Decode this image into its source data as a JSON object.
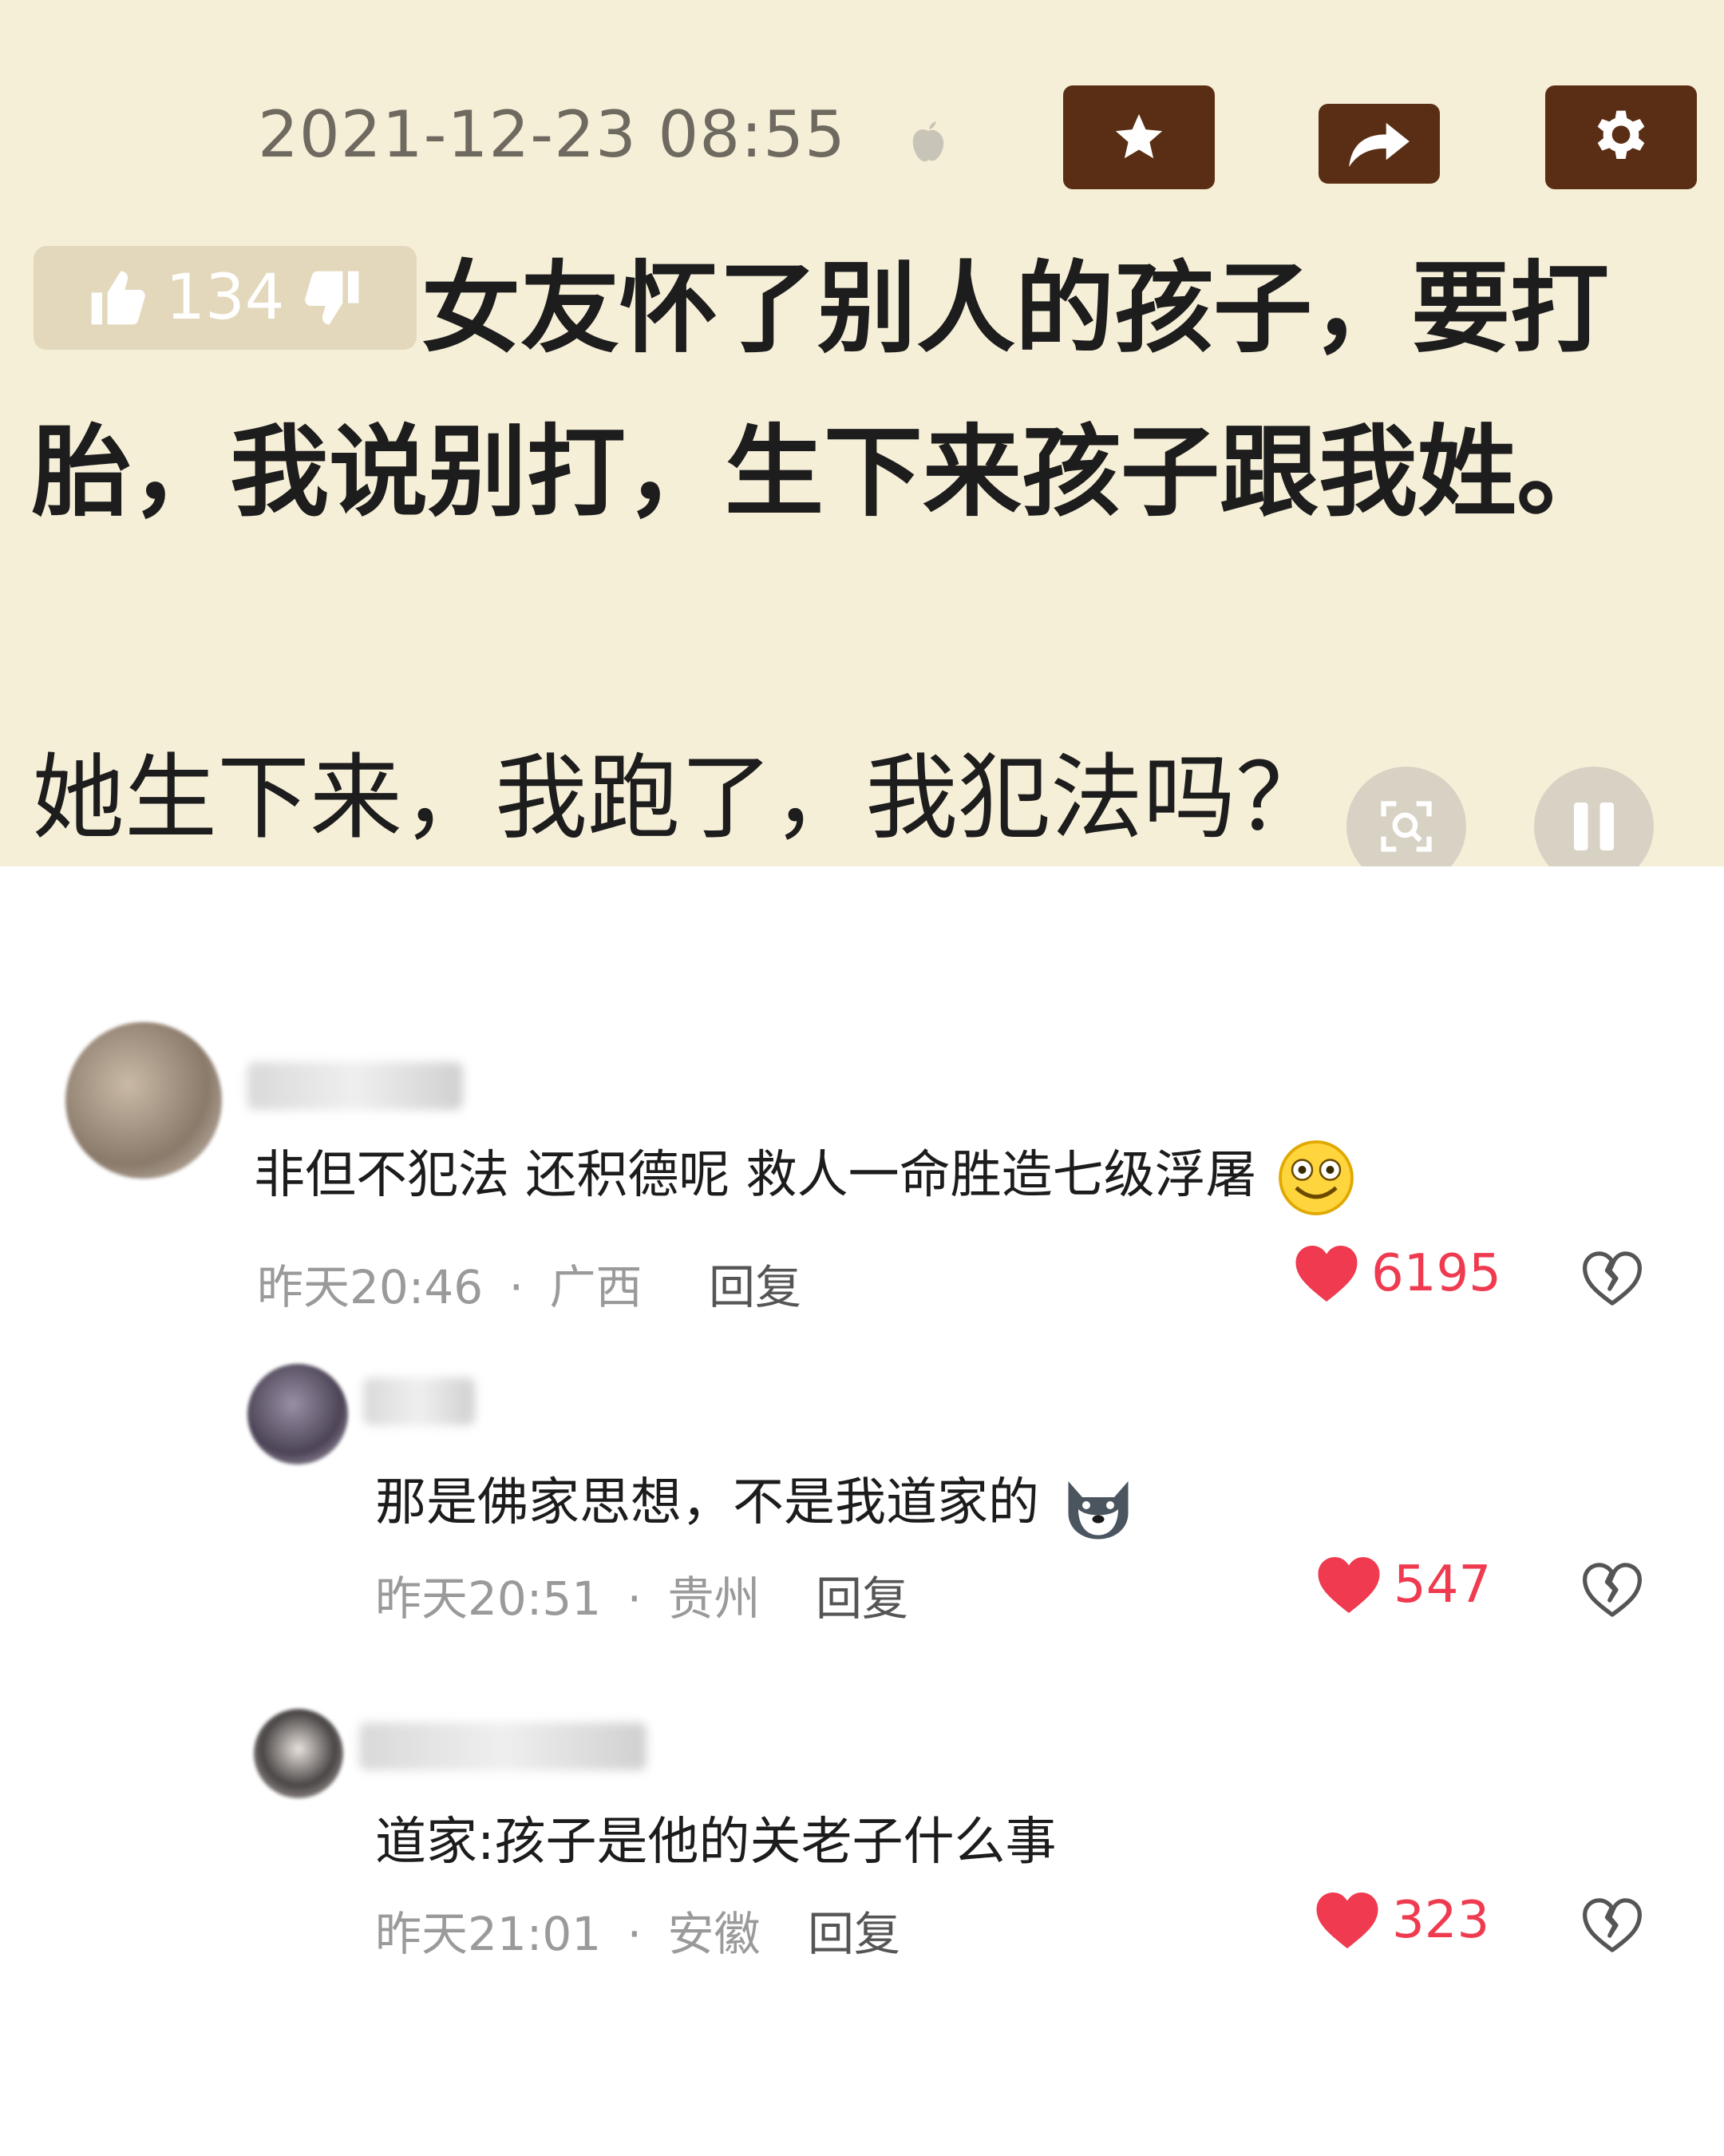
{
  "post": {
    "timestamp": "2021-12-23 08:55",
    "vote_count": "134",
    "title": "女友怀了别人的孩子，要打胎，我说别打，生下来孩子跟我姓。",
    "question": "她生下来，我跑了，我犯法吗？"
  },
  "comments": [
    {
      "text": "非但不犯法 还积德呢 救人一命胜造七级浮屠",
      "time": "昨天20:46",
      "sep": "·",
      "location": "广西",
      "reply_label": "回复",
      "likes": "6195",
      "emoji": "smiley-emoji"
    },
    {
      "text": "那是佛家思想，不是我道家的",
      "time": "昨天20:51",
      "sep": "·",
      "location": "贵州",
      "reply_label": "回复",
      "likes": "547",
      "emoji": "husky-emoji"
    },
    {
      "text": "道家:孩子是他的关老子什么事",
      "time": "昨天21:01",
      "sep": "·",
      "location": "安徽",
      "reply_label": "回复",
      "likes": "323"
    }
  ],
  "colors": {
    "post_bg": "#f6efd8",
    "tool_btn": "#5a2e14",
    "like_red": "#ef3a4f"
  }
}
